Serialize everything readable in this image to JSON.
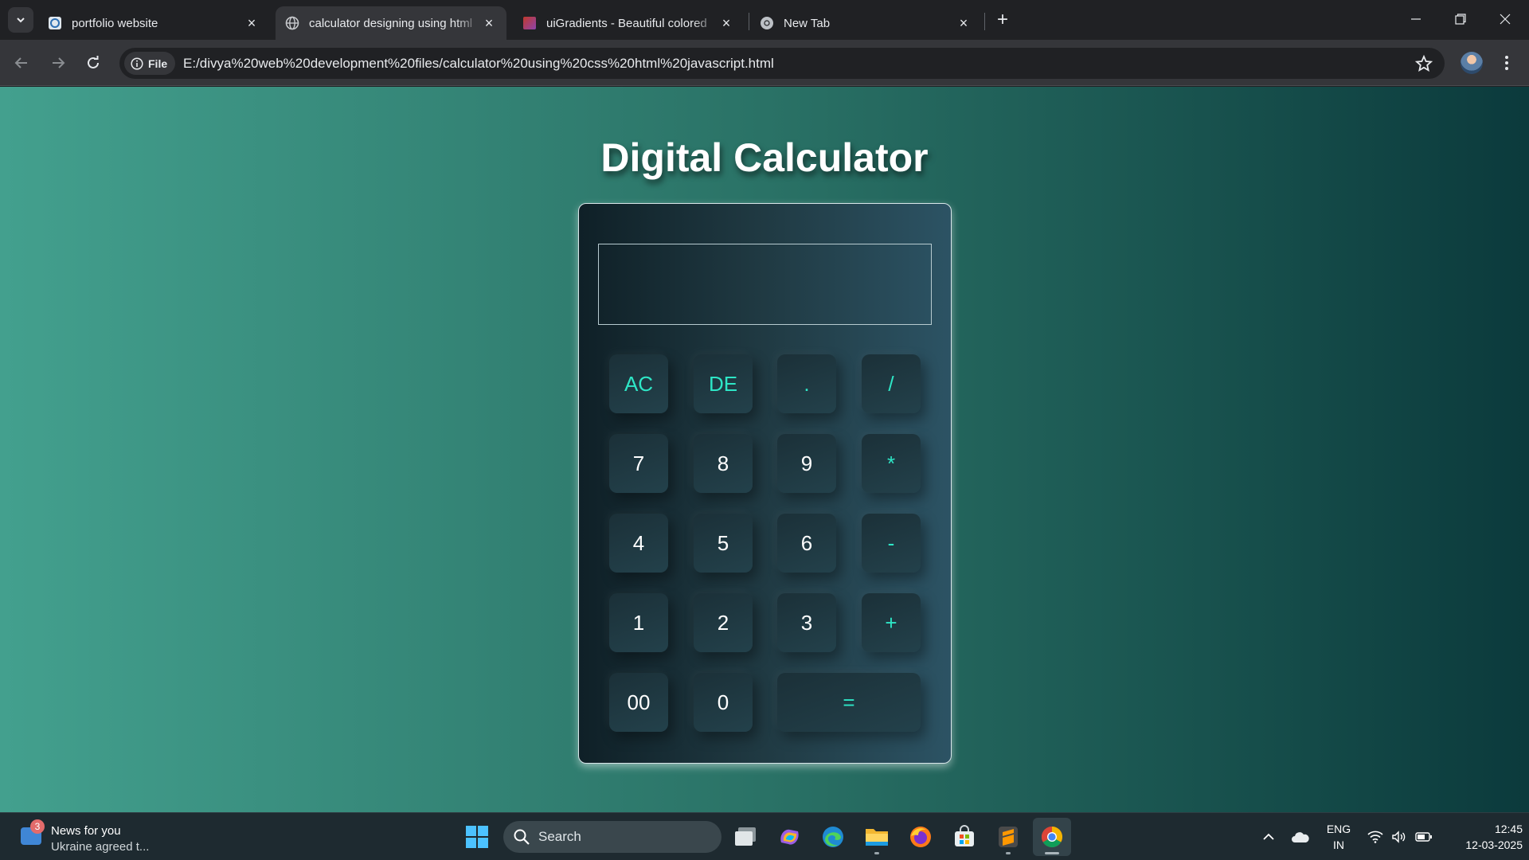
{
  "browser": {
    "tabs": [
      {
        "title": "portfolio website",
        "icon": "portfolio-favicon"
      },
      {
        "title": "calculator designing using html",
        "icon": "globe-icon",
        "active": true
      },
      {
        "title": "uiGradients - Beautiful colored",
        "icon": "uigradients-favicon"
      },
      {
        "title": "New Tab",
        "icon": "chrome-icon"
      }
    ],
    "tab_close": "×",
    "new_tab": "+",
    "url_chip": "File",
    "url": "E:/divya%20web%20development%20files/calculator%20using%20css%20html%20javascript.html"
  },
  "page": {
    "title": "Digital Calculator",
    "display_value": "",
    "keys": [
      {
        "label": "AC",
        "kind": "op"
      },
      {
        "label": "DE",
        "kind": "op"
      },
      {
        "label": ".",
        "kind": "op"
      },
      {
        "label": "/",
        "kind": "op"
      },
      {
        "label": "7",
        "kind": "num"
      },
      {
        "label": "8",
        "kind": "num"
      },
      {
        "label": "9",
        "kind": "num"
      },
      {
        "label": "*",
        "kind": "op"
      },
      {
        "label": "4",
        "kind": "num"
      },
      {
        "label": "5",
        "kind": "num"
      },
      {
        "label": "6",
        "kind": "num"
      },
      {
        "label": "-",
        "kind": "op"
      },
      {
        "label": "1",
        "kind": "num"
      },
      {
        "label": "2",
        "kind": "num"
      },
      {
        "label": "3",
        "kind": "num"
      },
      {
        "label": "+",
        "kind": "op"
      },
      {
        "label": "00",
        "kind": "num"
      },
      {
        "label": "0",
        "kind": "num"
      },
      {
        "label": "=",
        "kind": "op"
      }
    ],
    "colors": {
      "background_left": "#43a08e",
      "background_right": "#0b3a3c",
      "calculator_gradient": [
        "#0f2027",
        "#203a43",
        "#2c5364"
      ],
      "operator_text": "#2ee6c6",
      "number_text": "#ffffff"
    }
  },
  "taskbar": {
    "news_badge": "3",
    "news_title": "News for you",
    "news_subtitle": "Ukraine agreed t...",
    "search_label": "Search",
    "lang_line1": "ENG",
    "lang_line2": "IN",
    "time": "12:45",
    "date": "12-03-2025",
    "apps": [
      "windows-start-icon",
      "task-view-icon",
      "copilot-icon",
      "edge-icon",
      "file-explorer-icon",
      "firefox-icon",
      "microsoft-store-icon",
      "sublime-text-icon",
      "chrome-icon"
    ]
  }
}
